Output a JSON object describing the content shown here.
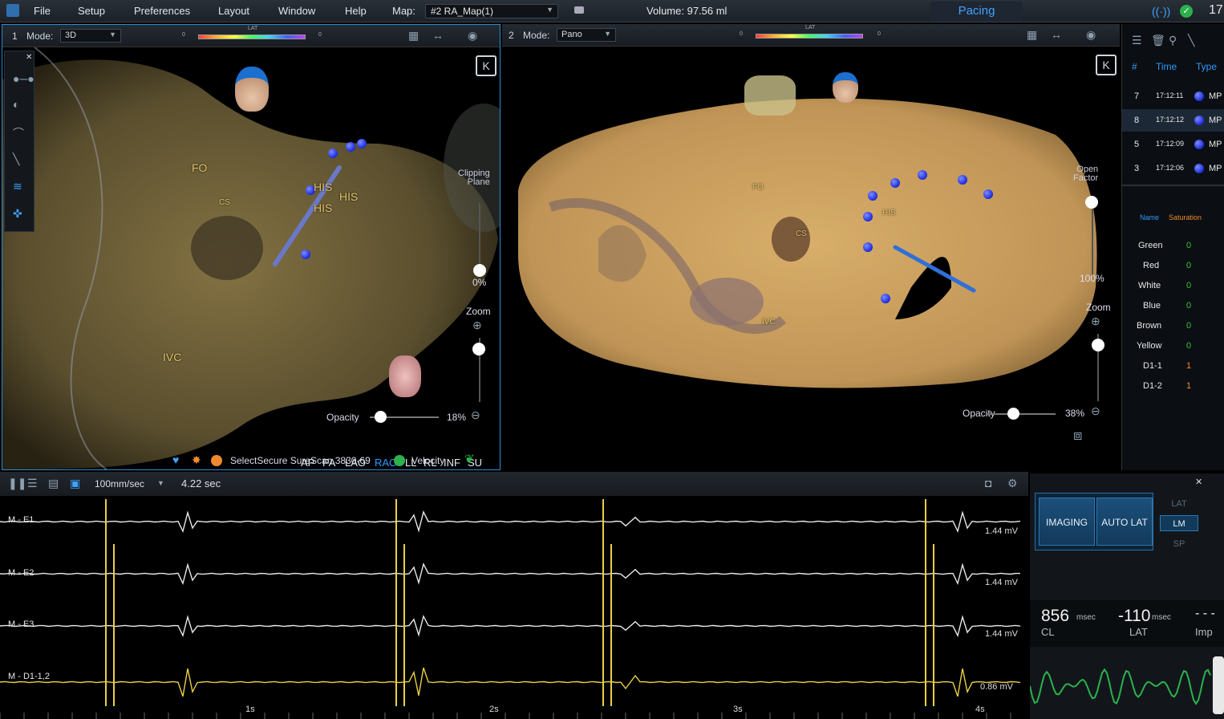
{
  "menubar": {
    "items": [
      "File",
      "Setup",
      "Preferences",
      "Layout",
      "Window",
      "Help"
    ],
    "map_label": "Map:",
    "map_value": "#2 RA_Map(1)",
    "volume": "Volume: 97.56 ml",
    "pacing": "Pacing",
    "right_num": "17"
  },
  "left_view": {
    "index": "1",
    "mode_label": "Mode:",
    "mode_value": "3D",
    "lat_label": "LAT",
    "lat_min": "0",
    "lat_max": "0",
    "clipping_label": "Clipping\nPlane",
    "clip_value": "0%",
    "zoom_label": "Zoom",
    "opacity_label": "Opacity",
    "opacity_value": "18%",
    "anat_labels": [
      "FO",
      "CS",
      "HIS",
      "HIS",
      "HIS",
      "IVC"
    ],
    "views": [
      "AP",
      "PA",
      "LAO",
      "RAO",
      "LL",
      "RL",
      "INF",
      "SU"
    ],
    "active_view": "RAO",
    "catheter": "SelectSecure SureScan 3830-69",
    "velocity": "Velocity"
  },
  "right_view": {
    "index": "2",
    "mode_label": "Mode:",
    "mode_value": "Pano",
    "lat_label": "LAT",
    "lat_min": "0",
    "lat_max": "0",
    "open_factor_label": "Open\nFactor",
    "open_value": "100%",
    "zoom_label": "Zoom",
    "opacity_label": "Opacity",
    "opacity_value": "38%",
    "anat_labels": [
      "FO",
      "CS",
      "HIS",
      "IVC"
    ]
  },
  "points_table": {
    "headers": [
      "#",
      "Time",
      "Type"
    ],
    "rows": [
      {
        "num": "7",
        "time": "17:12:11",
        "type": "MP"
      },
      {
        "num": "8",
        "time": "17:12:12",
        "type": "MP"
      },
      {
        "num": "5",
        "time": "17:12:09",
        "type": "MP"
      },
      {
        "num": "3",
        "time": "17:12:06",
        "type": "MP"
      }
    ],
    "sat_headers": [
      "Name",
      "Saturation"
    ],
    "sat_rows": [
      {
        "name": "Green",
        "value": "0"
      },
      {
        "name": "Red",
        "value": "0"
      },
      {
        "name": "White",
        "value": "0"
      },
      {
        "name": "Blue",
        "value": "0"
      },
      {
        "name": "Brown",
        "value": "0"
      },
      {
        "name": "Yellow",
        "value": "0"
      },
      {
        "name": "D1-1",
        "value": "1"
      },
      {
        "name": "D1-2",
        "value": "1"
      }
    ]
  },
  "egm": {
    "speed": "100mm/sec",
    "time": "4.22 sec",
    "traces": [
      {
        "label": "M - E1",
        "scale": "1.44 mV"
      },
      {
        "label": "M - E2",
        "scale": "1.44 mV"
      },
      {
        "label": "M - E3",
        "scale": "1.44 mV"
      },
      {
        "label": "M - D1-1,2",
        "scale": "0.86 mV"
      }
    ],
    "time_ticks": [
      "1s",
      "2s",
      "3s",
      "4s"
    ]
  },
  "control": {
    "imaging": "IMAGING",
    "auto_lat": "AUTO LAT",
    "modes": [
      "LAT",
      "LM",
      "SP"
    ],
    "active_mode": "LM",
    "cl_value": "856",
    "cl_unit": "msec",
    "cl_label": "CL",
    "lat_value": "-110",
    "lat_unit": "msec",
    "lat_label": "LAT",
    "imp_value": "- - -",
    "imp_label": "Imp"
  },
  "colors": {
    "accent": "#2f9bff",
    "tissue": "#b89458",
    "trace": "#e8e8e8",
    "pace": "#e8d044"
  }
}
